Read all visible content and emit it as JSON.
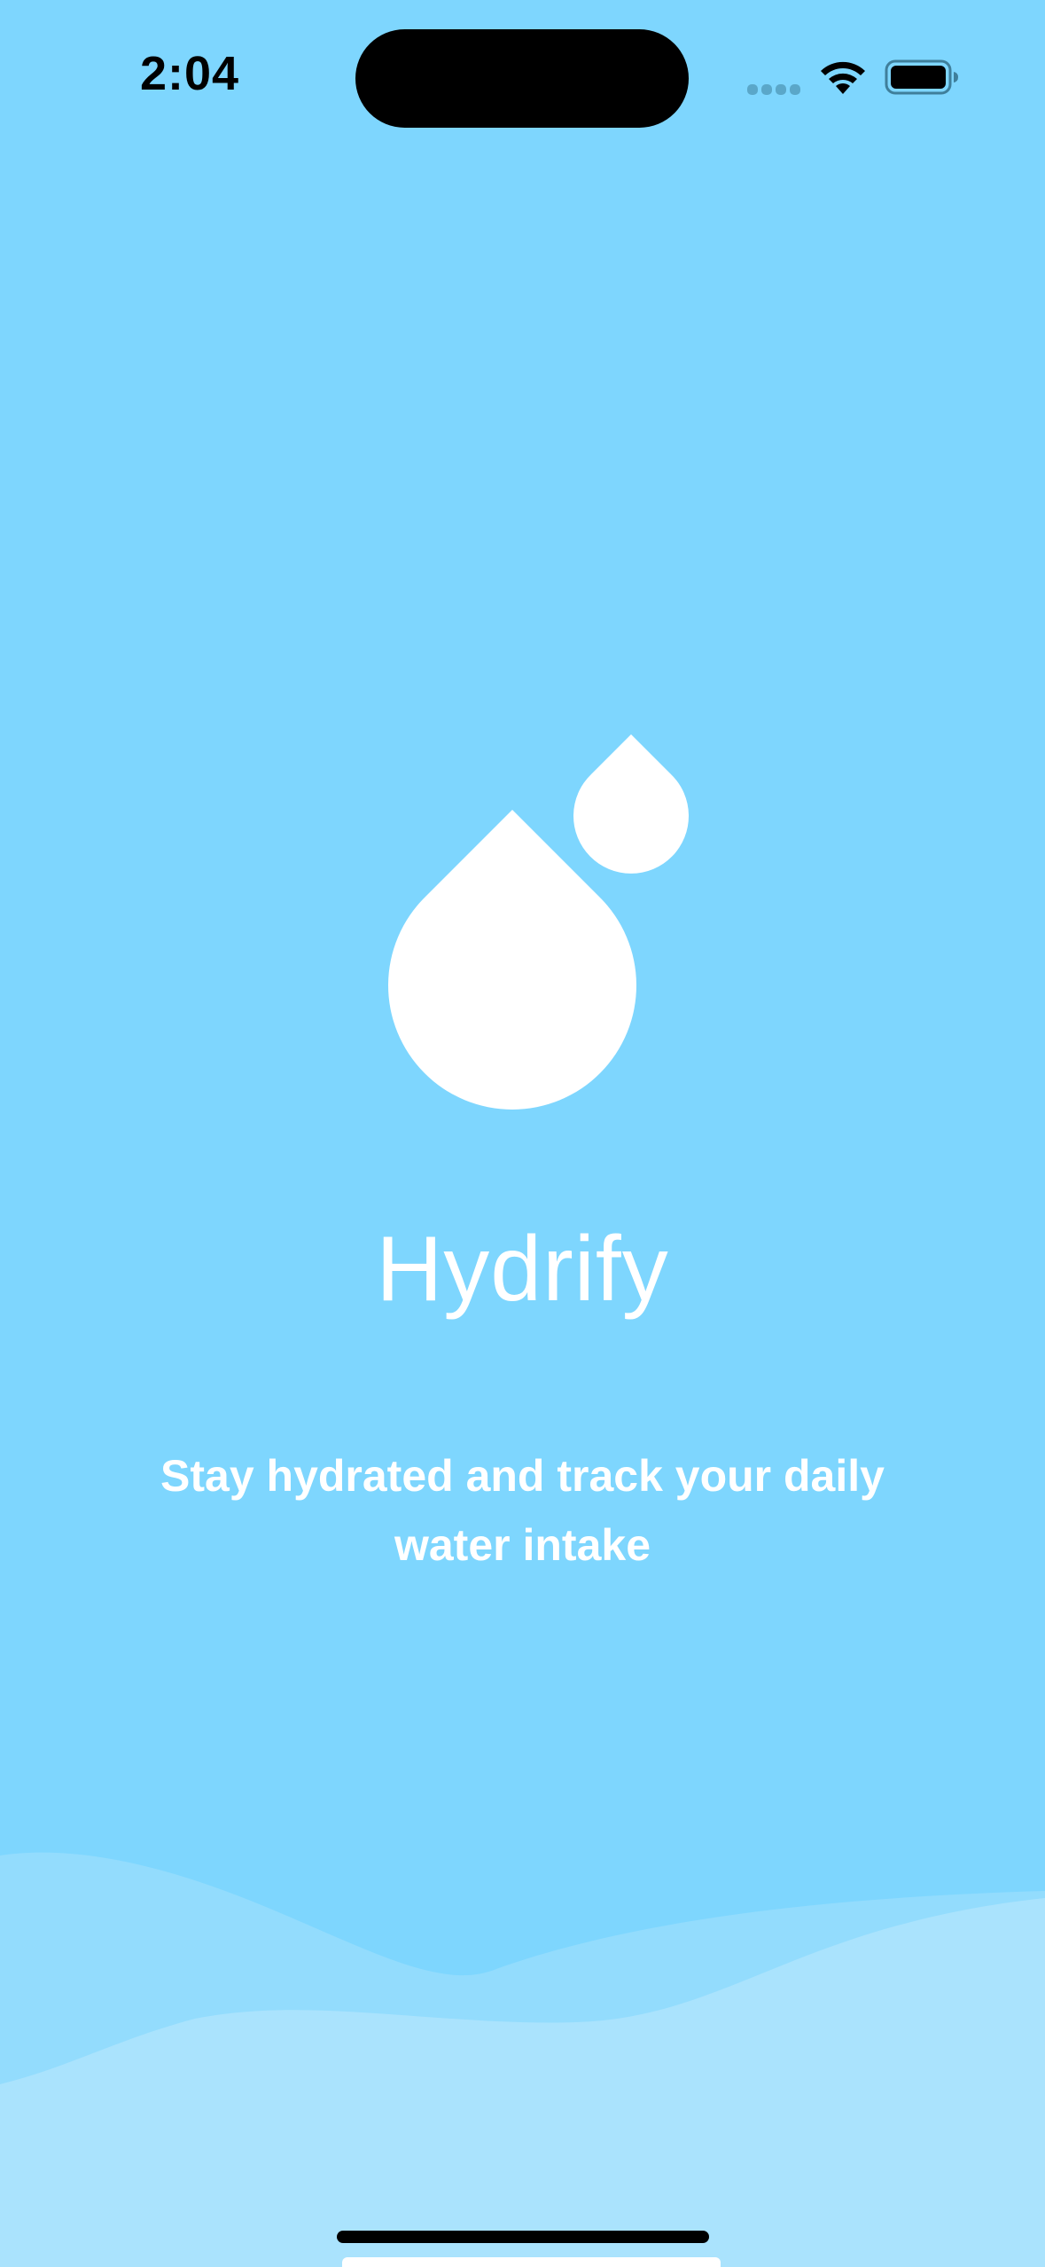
{
  "status_bar": {
    "time": "2:04"
  },
  "splash": {
    "app_name": "Hydrify",
    "tagline": "Stay hydrated and track your daily water intake",
    "logo_icon": "water-drops-icon"
  },
  "colors": {
    "background": "#7ed6fe",
    "wave_mid": "#93dcfd",
    "wave_front": "#aae3fd",
    "text": "#ffffff"
  }
}
